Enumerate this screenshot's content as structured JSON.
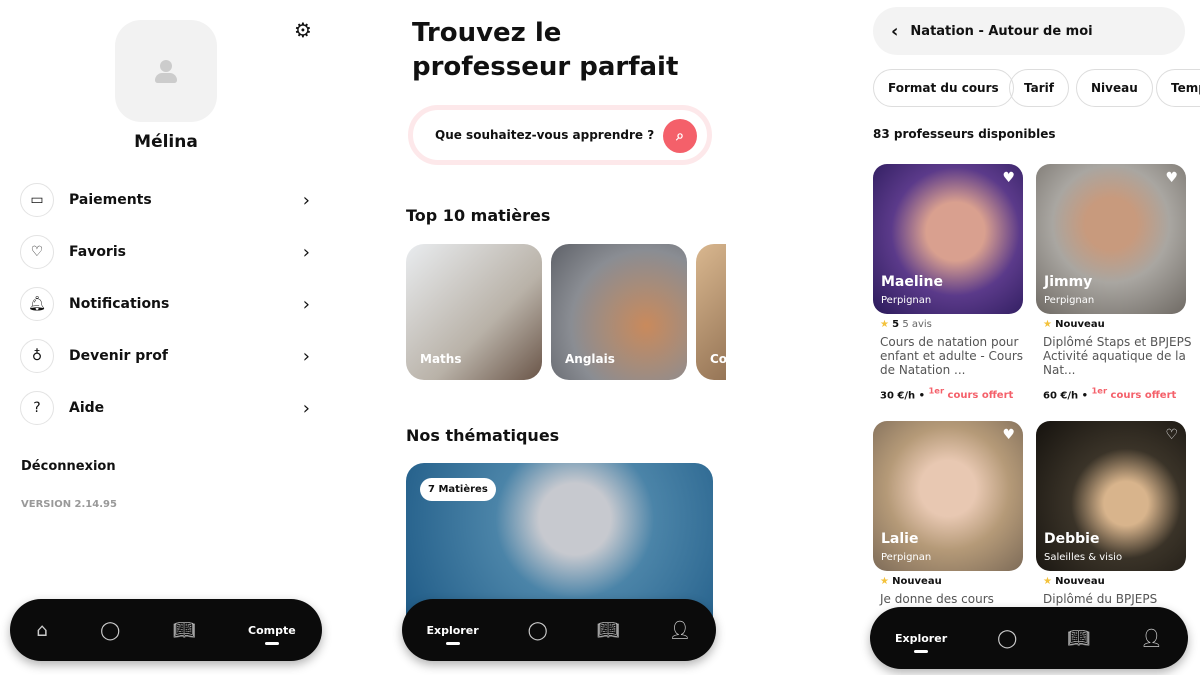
{
  "account": {
    "user_name": "Mélina",
    "menu": [
      {
        "label": "Paiements",
        "icon": "credit-card-icon"
      },
      {
        "label": "Favoris",
        "icon": "heart-icon"
      },
      {
        "label": "Notifications",
        "icon": "bell-icon"
      },
      {
        "label": "Devenir prof",
        "icon": "award-icon"
      },
      {
        "label": "Aide",
        "icon": "help-icon"
      }
    ],
    "logout": "Déconnexion",
    "version": "VERSION 2.14.95",
    "nav_active": "Compte"
  },
  "explore": {
    "title_line1": "Trouvez le",
    "title_line2": "professeur parfait",
    "search_placeholder": "Que souhaitez-vous apprendre ?",
    "top_title": "Top 10 matières",
    "subjects": [
      "Maths",
      "Anglais",
      "Co"
    ],
    "themes_title": "Nos thématiques",
    "theme_badge": "7 Matières",
    "nav_active": "Explorer"
  },
  "results": {
    "back_title": "Natation - Autour de moi",
    "filters": [
      "Format du cours",
      "Tarif",
      "Niveau",
      "Temp"
    ],
    "count": "83 professeurs disponibles",
    "teachers": [
      {
        "name": "Maeline",
        "city": "Perpignan",
        "rating": "5",
        "reviews": "5 avis",
        "desc": "Cours de natation pour enfant et adulte - Cours de Natation ...",
        "price": "30 €/h",
        "offer_sup": "1er",
        "offer": " cours offert"
      },
      {
        "name": "Jimmy",
        "city": "Perpignan",
        "rating": "",
        "reviews": "Nouveau",
        "desc": "Diplômé Staps et BPJEPS Activité aquatique de la Nat...",
        "price": "60 €/h",
        "offer_sup": "1er",
        "offer": " cours offert"
      },
      {
        "name": "Lalie",
        "city": "Perpignan",
        "rating": "",
        "reviews": "Nouveau",
        "desc": "Je donne des cours"
      },
      {
        "name": "Debbie",
        "city": "Saleilles & visio",
        "rating": "",
        "reviews": "Nouveau",
        "desc": "Diplômé du BPJEPS"
      }
    ],
    "nav_active": "Explorer"
  },
  "colors": {
    "accent": "#f4606a",
    "star": "#f3c23c",
    "nav": "#0b0b0b"
  }
}
